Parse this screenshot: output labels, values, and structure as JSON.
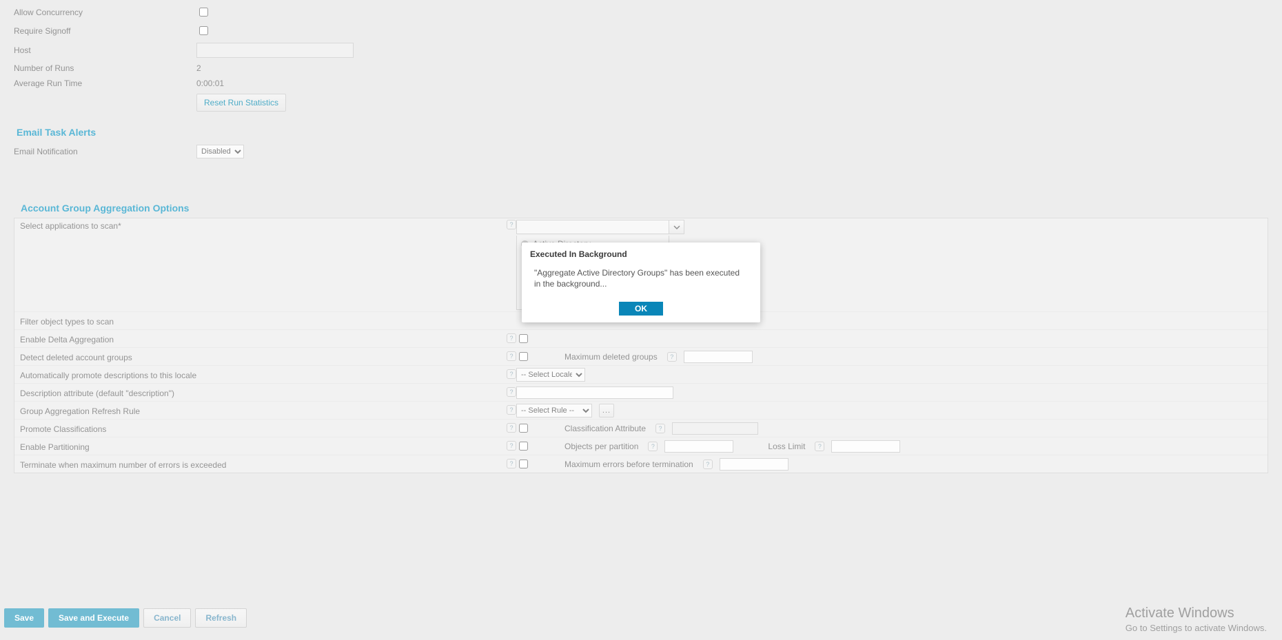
{
  "topForm": {
    "allowConcurrencyLabel": "Allow Concurrency",
    "requireSignoffLabel": "Require Signoff",
    "hostLabel": "Host",
    "hostValue": "",
    "numberOfRunsLabel": "Number of Runs",
    "numberOfRunsValue": "2",
    "averageRunTimeLabel": "Average Run Time",
    "averageRunTimeValue": "0:00:01",
    "resetRunStatsButton": "Reset Run Statistics"
  },
  "emailSection": {
    "heading": "Email Task Alerts",
    "emailNotificationLabel": "Email Notification",
    "emailNotificationOption": "Disabled"
  },
  "agg": {
    "heading": "Account Group Aggregation Options",
    "selectAppsLabel": "Select applications to scan*",
    "comboValue": "",
    "appListItem": "Active Directory",
    "filterObjectTypesLabel": "Filter object types to scan",
    "enableDeltaLabel": "Enable Delta Aggregation",
    "detectDeletedLabel": "Detect deleted account groups",
    "maxDeletedGroupsLabel": "Maximum deleted groups",
    "autoPromoteLabel": "Automatically promote descriptions to this locale",
    "selectLocaleOption": "-- Select Locale --",
    "descAttributeLabel": "Description attribute (default \"description\")",
    "descAttributeValue": "",
    "refreshRuleLabel": "Group Aggregation Refresh Rule",
    "selectRuleOption": "-- Select Rule --",
    "ellipsis": "...",
    "promoteClassLabel": "Promote Classifications",
    "classAttrLabel": "Classification Attribute",
    "enablePartLabel": "Enable Partitioning",
    "objectsPerPartLabel": "Objects per partition",
    "lossLimitLabel": "Loss Limit",
    "terminateLabel": "Terminate when maximum number of errors is exceeded",
    "maxErrorsLabel": "Maximum errors before termination"
  },
  "footer": {
    "save": "Save",
    "saveExecute": "Save and Execute",
    "cancel": "Cancel",
    "refresh": "Refresh"
  },
  "dialog": {
    "title": "Executed In Background",
    "body": "\"Aggregate Active Directory Groups\" has been executed in the background...",
    "ok": "OK"
  },
  "watermark": {
    "line1": "Activate Windows",
    "line2": "Go to Settings to activate Windows."
  }
}
